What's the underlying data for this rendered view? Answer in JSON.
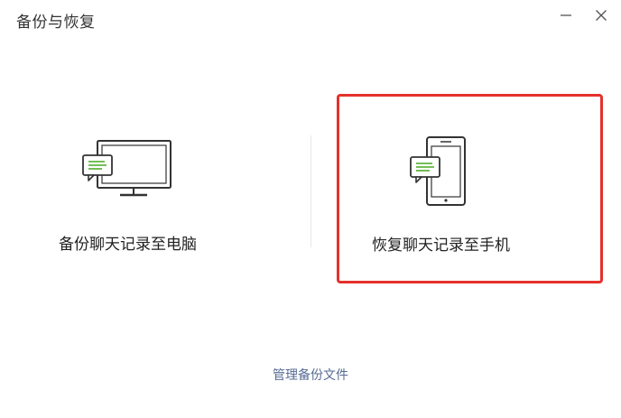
{
  "window": {
    "title": "备份与恢复",
    "minimize_icon": "minimize-icon",
    "close_icon": "close-icon"
  },
  "options": [
    {
      "label": "备份聊天记录至电脑",
      "icon": "computer-chat-icon"
    },
    {
      "label": "恢复聊天记录至手机",
      "icon": "phone-chat-icon",
      "highlighted": true,
      "highlight_color": "#e5312b"
    }
  ],
  "footer": {
    "manage_label": "管理备份文件",
    "link_color": "#576b95"
  },
  "colors": {
    "accent_green": "#62b640",
    "icon_stroke": "#333333"
  }
}
